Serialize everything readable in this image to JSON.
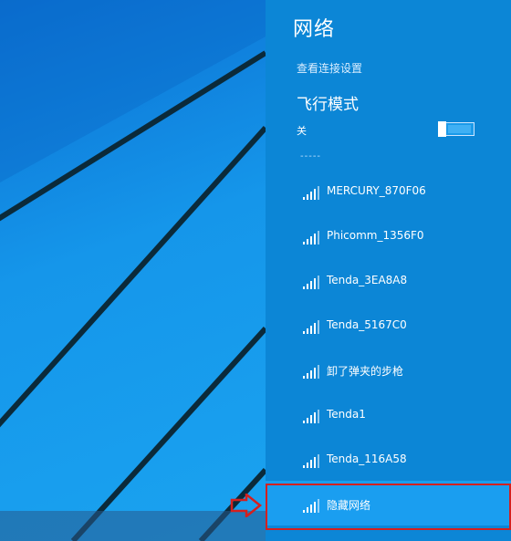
{
  "panel": {
    "title": "网络",
    "view_settings_link": "查看连接设置",
    "airplane_mode": {
      "title": "飞行模式",
      "state_label": "关",
      "enabled": false
    },
    "separator": "-----",
    "networks": [
      {
        "name": "MERCURY_870F06",
        "icon": "wifi-signal-icon"
      },
      {
        "name": "Phicomm_1356F0",
        "icon": "wifi-signal-icon"
      },
      {
        "name": "Tenda_3EA8A8",
        "icon": "wifi-signal-icon"
      },
      {
        "name": "Tenda_5167C0",
        "icon": "wifi-signal-icon"
      },
      {
        "name": "卸了弹夹的步枪",
        "icon": "wifi-signal-icon"
      },
      {
        "name": "Tenda1",
        "icon": "wifi-signal-icon"
      },
      {
        "name": "Tenda_116A58",
        "icon": "wifi-signal-icon"
      },
      {
        "name": "隐藏网络",
        "icon": "wifi-signal-icon",
        "highlighted": true
      }
    ]
  },
  "annotation": {
    "box_color": "#d4201f",
    "arrow_icon": "red-arrow-icon"
  },
  "colors": {
    "panel_bg": "#0c86d6",
    "desktop_bg": "#1596ea",
    "highlight_bg": "#1a9ef0"
  }
}
